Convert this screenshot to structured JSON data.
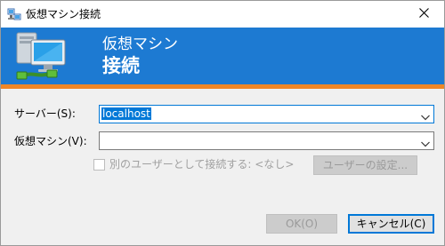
{
  "window": {
    "title": "仮想マシン接続",
    "icon": "vm-connect-icon",
    "close_icon": "close-icon"
  },
  "banner": {
    "subtitle": "仮想マシン",
    "title": "接続",
    "art_icon": "computer-network-icon",
    "background_color": "#1d7ad2",
    "accent_color": "#ef8626"
  },
  "form": {
    "server_label": "サーバー(S):",
    "server_value": "localhost",
    "vm_label": "仮想マシン(V):",
    "vm_value": "",
    "other_user_checkbox_label": "別のユーザーとして接続する: <なし>",
    "other_user_checked": false,
    "user_settings_button": "ユーザーの設定..."
  },
  "buttons": {
    "ok": "OK(O)",
    "cancel": "キャンセル(C)"
  }
}
